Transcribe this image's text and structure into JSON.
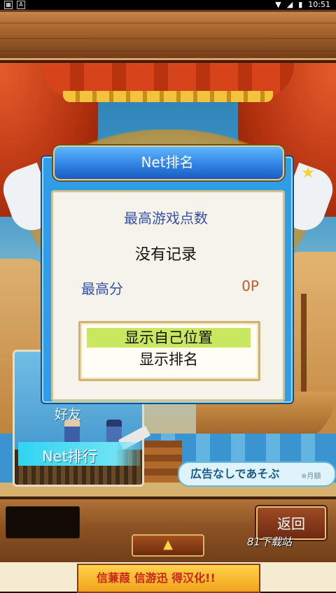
{
  "status": {
    "time": "10:51"
  },
  "dialog": {
    "title": "Net排名",
    "subtitle": "最高游戏点数",
    "no_record": "没有记录",
    "best_label": "最高分",
    "best_value": "0P",
    "options": [
      "显示自己位置",
      "显示排名"
    ],
    "selected_option_index": 0
  },
  "friends_tile": {
    "label": "好友",
    "net_rank_label": "Net排行"
  },
  "ad_pill": {
    "text": "広告なしであそぶ",
    "sub": "※月額"
  },
  "bottom": {
    "back_label": "返回",
    "up_arrow": "▲",
    "watermark": "81下载站"
  },
  "banner": {
    "text": "信蒹葭 信游迅 得汉化!!"
  },
  "colors": {
    "dialog_blue": "#2f9ee6",
    "option_highlight": "#c9e85f",
    "title_text_blue": "#3450a8",
    "score_orange": "#c25a2a"
  }
}
